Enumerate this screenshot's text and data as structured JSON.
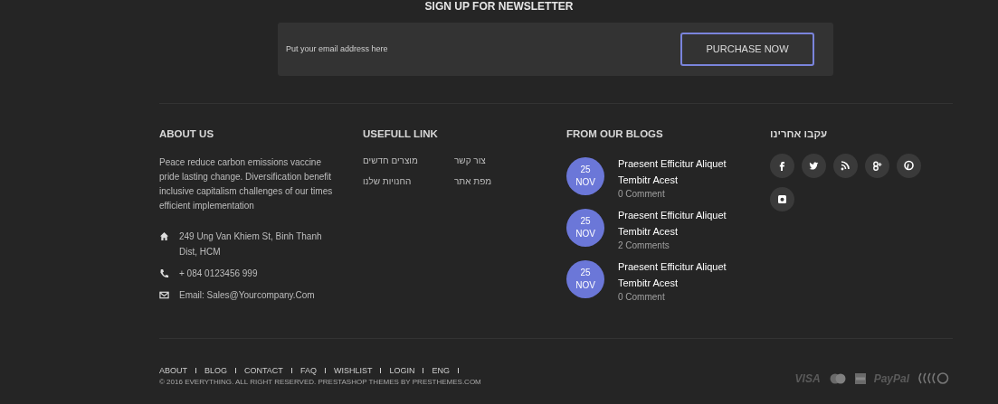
{
  "newsletter": {
    "title": "SIGN UP FOR NEWSLETTER",
    "placeholder": "Put your email address here",
    "button": "PURCHASE NOW"
  },
  "about": {
    "title": "ABOUT US",
    "text": "Peace reduce carbon emissions vaccine pride lasting change. Diversification benefit inclusive capitalism challenges of our times efficient implementation",
    "contacts": [
      {
        "kind": "address",
        "text": "249 Ung Van Khiem St, Binh Thanh Dist, HCM"
      },
      {
        "kind": "phone",
        "text": "+ 084 0123456 999"
      },
      {
        "kind": "email",
        "text": "Email: Sales@Yourcompany.Com"
      }
    ]
  },
  "links": {
    "title": "USEFULL LINK",
    "items": [
      "מוצרים חדשים",
      "צור קשר",
      "החנויות שלנו",
      "מפת אתר"
    ]
  },
  "blogs": {
    "title": "FROM OUR BLOGS",
    "posts": [
      {
        "day": "25",
        "month": "NOV",
        "title": "Praesent Efficitur Aliquet Tembitr Acest",
        "comments": "0 Comment"
      },
      {
        "day": "25",
        "month": "NOV",
        "title": "Praesent Efficitur Aliquet Tembitr Acest",
        "comments": "2 Comments"
      },
      {
        "day": "25",
        "month": "NOV",
        "title": "Praesent Efficitur Aliquet Tembitr Acest",
        "comments": "0 Comment"
      }
    ]
  },
  "follow": {
    "title": "עקבו אחרינו",
    "networks": [
      {
        "kind": "facebook"
      },
      {
        "kind": "twitter"
      },
      {
        "kind": "rss"
      },
      {
        "kind": "googleplus"
      },
      {
        "kind": "pinterest"
      },
      {
        "kind": "instagram"
      }
    ]
  },
  "bottom_links": [
    "ABOUT",
    "BLOG",
    "CONTACT",
    "FAQ",
    "WISHLIST",
    "LOGIN",
    "ENG"
  ],
  "copyright": "© 2016 EVERYTHING. ALL RIGHT RESERVED. PRESTASHOP THEMES BY PRESTHEMES.COM",
  "payments": [
    {
      "kind": "text",
      "text": "VISA"
    },
    {
      "kind": "mastercard"
    },
    {
      "kind": "amex"
    },
    {
      "kind": "text",
      "text": "PayPal"
    },
    {
      "kind": "contactless"
    }
  ]
}
